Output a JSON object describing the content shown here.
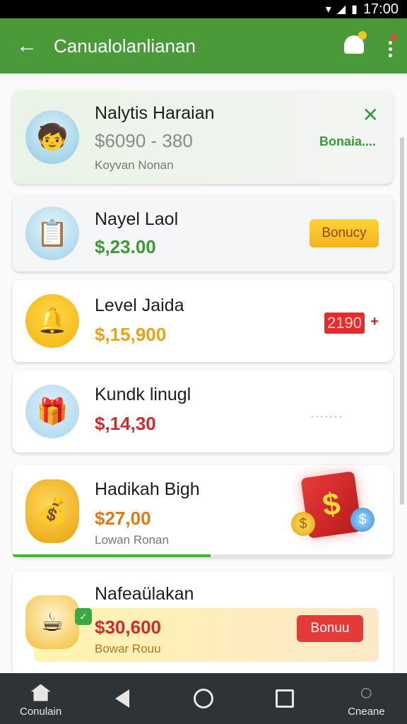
{
  "status_bar": {
    "time": "17:00"
  },
  "app_bar": {
    "title": "Canualolanlianan"
  },
  "items": [
    {
      "name": "Nalytis Haraian",
      "amount": "$6090 - 380",
      "amount_color": "#8a8a8a",
      "sub": "Koyvan Nonan",
      "action": "Bonaia....",
      "icon": "person-icon"
    },
    {
      "name": "Nayel Laol",
      "amount": "$,23.00",
      "amount_color": "#3c9a35",
      "action": "Bonucy",
      "icon": "tablet-icon"
    },
    {
      "name": "Level Jaida",
      "amount": "$,15,900",
      "amount_color": "#e8a316",
      "badge": "2190",
      "plus": "+",
      "icon": "bell-icon"
    },
    {
      "name": "Kundk linugl",
      "amount": "$,14,30",
      "amount_color": "#d02a2a",
      "dots": "·······",
      "icon": "gift-box-icon"
    },
    {
      "name": "Hadikah Bigh",
      "amount": "$27,00",
      "amount_color": "#e07a10",
      "sub": "Lowan Ronan",
      "progress": 0.52,
      "icon": "gold-pot-icon"
    },
    {
      "name": "Nafeaülakan",
      "amount": "$30,600",
      "amount_color": "#d02a2a",
      "sub": "Bowar Rouu",
      "action": "Bonuu",
      "icon": "tea-cup-coins-icon"
    }
  ],
  "nav": {
    "home_label": "Conulain",
    "recent_label": "Cneane"
  }
}
